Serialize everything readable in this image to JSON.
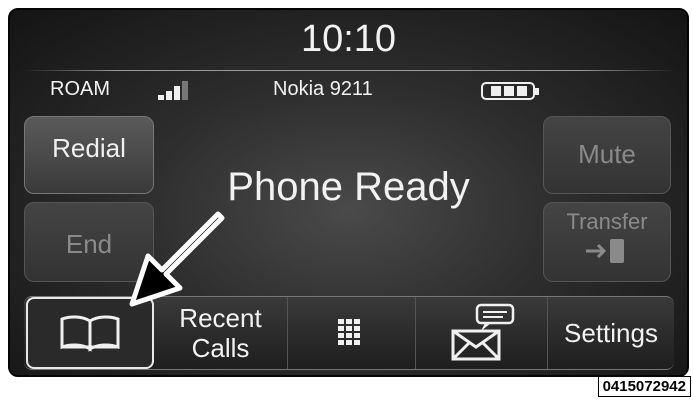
{
  "header": {
    "time": "10:10"
  },
  "status_bar": {
    "roaming": "ROAM",
    "signal_icon": "signal-bars-icon",
    "device_name": "Nokia 9211",
    "battery_icon": "battery-icon"
  },
  "phone_status": "Phone Ready",
  "left_buttons": {
    "redial": "Redial",
    "end": "End"
  },
  "right_buttons": {
    "mute": "Mute",
    "transfer": "Transfer"
  },
  "bottom_tabs": {
    "phonebook_icon": "phonebook-icon",
    "recent_calls_line1": "Recent",
    "recent_calls_line2": "Calls",
    "keypad_icon": "keypad-icon",
    "messaging_icon": "messaging-icon",
    "settings": "Settings"
  },
  "image_code": "0415072942",
  "colors": {
    "screen_bg": "#2d2d2d",
    "text": "#f2f2f2",
    "inactive_text": "#8a8a8a"
  }
}
